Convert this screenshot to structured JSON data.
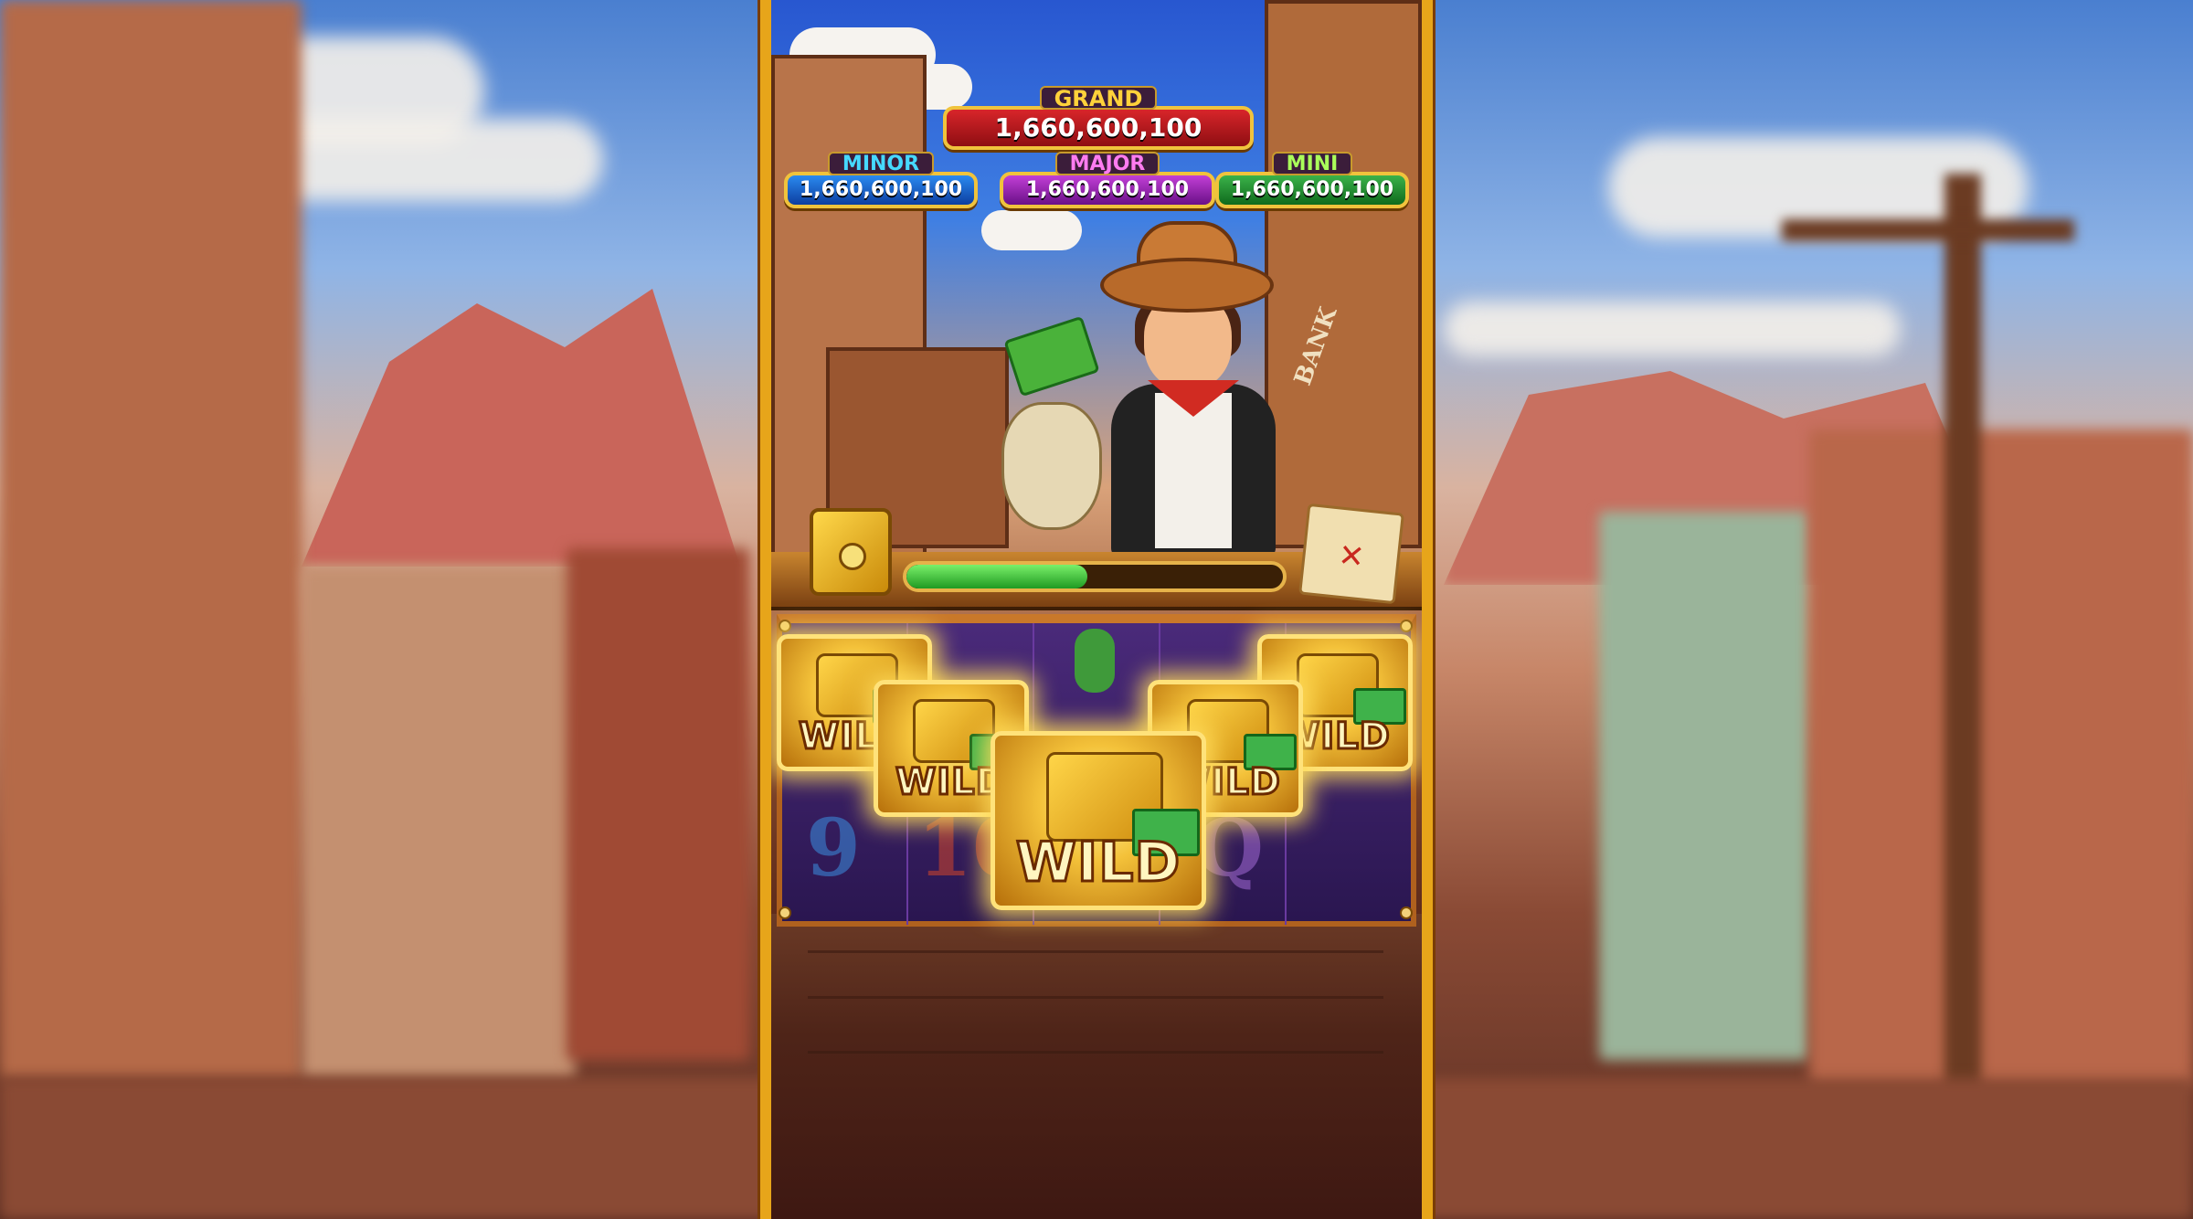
{
  "jackpots": {
    "grand": {
      "label": "GRAND",
      "value": "1,660,600,100"
    },
    "minor": {
      "label": "MINOR",
      "value": "1,660,600,100"
    },
    "major": {
      "label": "MAJOR",
      "value": "1,660,600,100"
    },
    "mini": {
      "label": "MINI",
      "value": "1,660,600,100"
    }
  },
  "progress": {
    "fraction": 0.48
  },
  "signs": {
    "bank": "BANK"
  },
  "wild_label": "WILD",
  "reel_symbols": {
    "nine": "9",
    "ten": "10",
    "queen": "Q"
  },
  "colors": {
    "frame_gold": "#e7a51a",
    "grand": "#d8252a",
    "minor": "#2a8af0",
    "major": "#c23fd6",
    "mini": "#3bb24a",
    "progress": "#4fcf44"
  },
  "icons": [
    "vault-icon",
    "treasure-map-icon",
    "money-bag-icon",
    "cash-icon",
    "cactus-icon"
  ]
}
